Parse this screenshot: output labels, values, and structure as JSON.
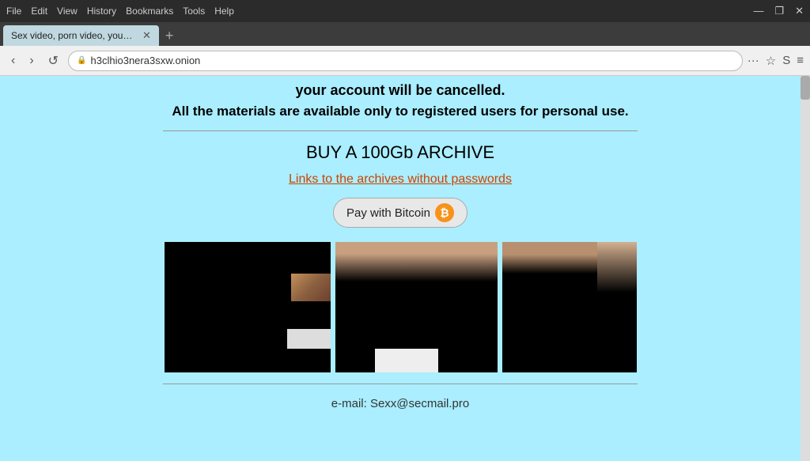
{
  "titlebar": {
    "menu_items": [
      "File",
      "Edit",
      "View",
      "History",
      "Bookmarks",
      "Tools",
      "Help"
    ],
    "win_minimize": "—",
    "win_restore": "❐",
    "win_close": "✕"
  },
  "tabs": {
    "active_tab": {
      "title": "Sex video, porn video, young porn...",
      "close": "✕"
    },
    "new_tab": "+"
  },
  "navbar": {
    "back": "‹",
    "forward": "›",
    "reload": "↺",
    "url": "h3clhio3nera3sxw.onion",
    "more": "···",
    "star": "☆",
    "sync": "S",
    "menu": "≡"
  },
  "page": {
    "account_warning": "your account will be cancelled.",
    "materials_notice": "All the materials are available only to registered users for personal use.",
    "section_heading": "BUY A 100Gb ARCHIVE",
    "archive_link": "Links to the archives without passwords",
    "bitcoin_button": "Pay with Bitcoin",
    "bitcoin_symbol": "₿",
    "email_label": "e-mail: Sexx@secmail.pro"
  }
}
